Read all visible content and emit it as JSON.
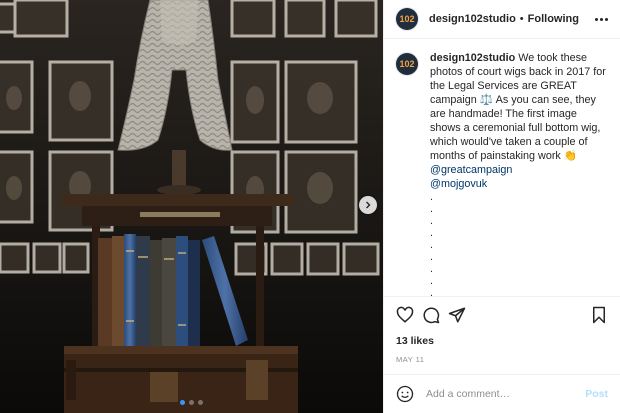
{
  "account": {
    "avatar_text": "102",
    "username": "design102studio",
    "separator": "•",
    "follow_status": "Following"
  },
  "caption": {
    "username": "design102studio",
    "text": "We took these photos of court wigs back in 2017 for the Legal Services are GREAT campaign ⚖️ As you can see, they are handmade! The first image shows a ceremonial full bottom wig, which would've taken a couple of months of painstaking work 👏",
    "mention_1": "@greatcampaign",
    "mention_2": "@mojgovuk",
    "ellipsis": [
      ".",
      ".",
      ".",
      ".",
      ".",
      ".",
      ".",
      ".",
      "."
    ]
  },
  "engagement": {
    "likes": "13 likes",
    "date": "MAY 11"
  },
  "comment": {
    "placeholder": "Add a comment…",
    "post_label": "Post"
  },
  "carousel": {
    "slide_count": 3,
    "active_slide": 1
  },
  "icons": {
    "like": "heart-icon",
    "comment": "comment-icon",
    "share": "share-icon",
    "save": "bookmark-icon",
    "emoji": "emoji-icon",
    "next": "chevron-right-icon",
    "more": "more-options-icon"
  },
  "colors": {
    "link": "#00376b",
    "post_disabled": "#b2dffc",
    "carousel_active": "#3897f0",
    "avatar_bg": "#1f2d3d",
    "avatar_text": "#f0a33c"
  }
}
